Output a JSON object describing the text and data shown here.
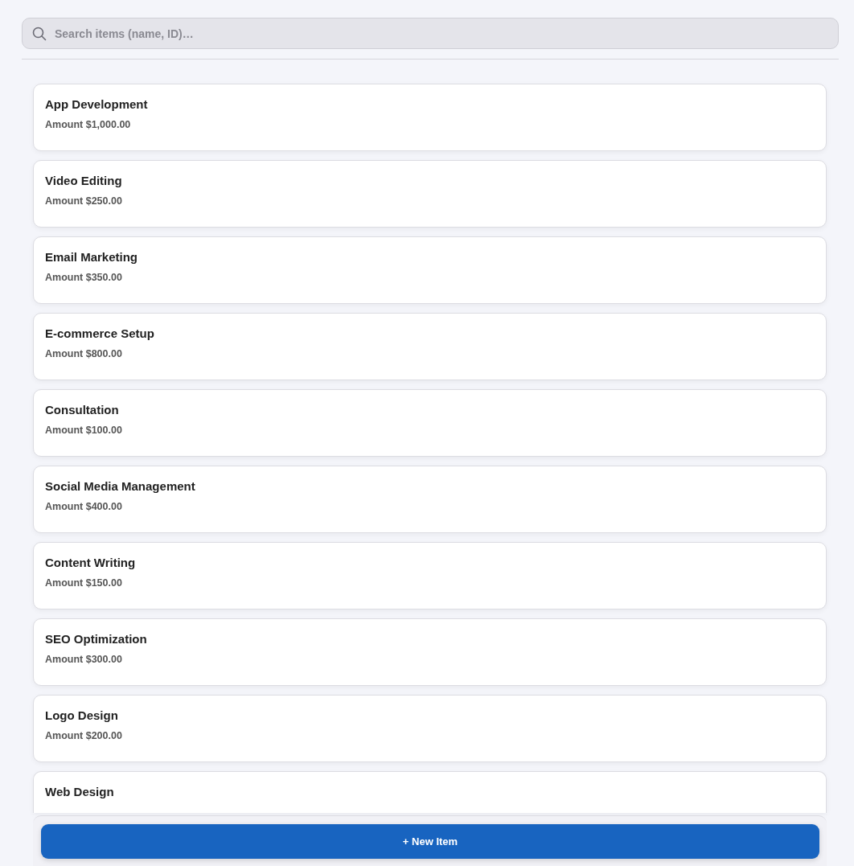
{
  "search": {
    "placeholder": "Search items (name, ID)…"
  },
  "items": [
    {
      "name": "App Development",
      "amount": "Amount $1,000.00"
    },
    {
      "name": "Video Editing",
      "amount": "Amount $250.00"
    },
    {
      "name": "Email Marketing",
      "amount": "Amount $350.00"
    },
    {
      "name": "E-commerce Setup",
      "amount": "Amount $800.00"
    },
    {
      "name": "Consultation",
      "amount": "Amount $100.00"
    },
    {
      "name": "Social Media Management",
      "amount": "Amount $400.00"
    },
    {
      "name": "Content Writing",
      "amount": "Amount $150.00"
    },
    {
      "name": "SEO Optimization",
      "amount": "Amount $300.00"
    },
    {
      "name": "Logo Design",
      "amount": "Amount $200.00"
    },
    {
      "name": "Web Design"
    }
  ],
  "new_button": "+ New Item"
}
